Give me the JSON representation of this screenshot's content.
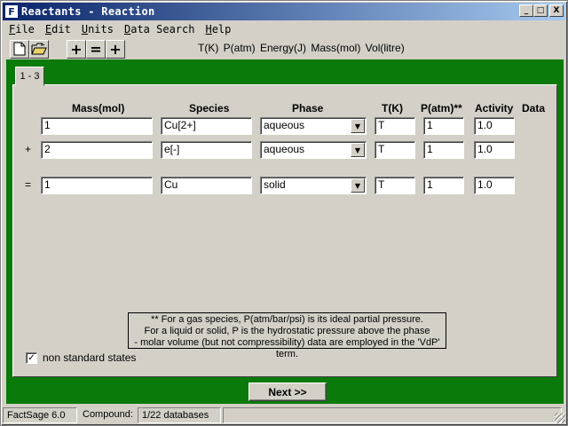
{
  "window": {
    "app_icon": "F",
    "title": "Reactants - Reaction",
    "controls": {
      "minimize": "_",
      "maximize": "□",
      "close": "X"
    }
  },
  "menu": {
    "items": [
      {
        "accel": "F",
        "rest": "ile"
      },
      {
        "accel": "E",
        "rest": "dit"
      },
      {
        "accel": "U",
        "rest": "nits"
      },
      {
        "accel": "D",
        "rest": "ata Search"
      },
      {
        "accel": "H",
        "rest": "elp"
      }
    ]
  },
  "toolbar": {
    "icons": [
      "new-file-icon",
      "open-folder-icon"
    ],
    "plus1": "+",
    "equals": "=",
    "plus2": "+",
    "units": "T(K)  P(atm)  Energy(J)  Mass(mol)  Vol(litre)"
  },
  "tab": {
    "label": "1 - 3"
  },
  "headers": {
    "mass": "Mass(mol)",
    "species": "Species",
    "phase": "Phase",
    "t": "T(K)",
    "p": "P(atm)**",
    "activity": "Activity",
    "data": "Data"
  },
  "rows": [
    {
      "sign": "",
      "mass": "1",
      "species": "Cu[2+]",
      "phase": "aqueous",
      "t": "T",
      "p": "1",
      "activity": "1.0"
    },
    {
      "sign": "+",
      "mass": "2",
      "species": "e[-]",
      "phase": "aqueous",
      "t": "T",
      "p": "1",
      "activity": "1.0"
    },
    {
      "sign": "=",
      "mass": "1",
      "species": "Cu",
      "phase": "solid",
      "t": "T",
      "p": "1",
      "activity": "1.0"
    }
  ],
  "note": {
    "line1": "** For a gas species, P(atm/bar/psi) is its ideal partial pressure.",
    "line2": "For a liquid or solid, P is the hydrostatic pressure above the phase",
    "line3": "- molar volume (but not compressibility) data are employed in the 'VdP' term."
  },
  "checkbox": {
    "label": "non standard states",
    "checked": true,
    "mark": "✓"
  },
  "next_button": {
    "label": "Next >>"
  },
  "statusbar": {
    "app": "FactSage 6.0",
    "compound_label": "Compound:",
    "databases": "1/22 databases"
  },
  "colors": {
    "title_bar": "#0a246a",
    "panel_frame": "#0a7a0a",
    "face": "#d4d0c8"
  }
}
